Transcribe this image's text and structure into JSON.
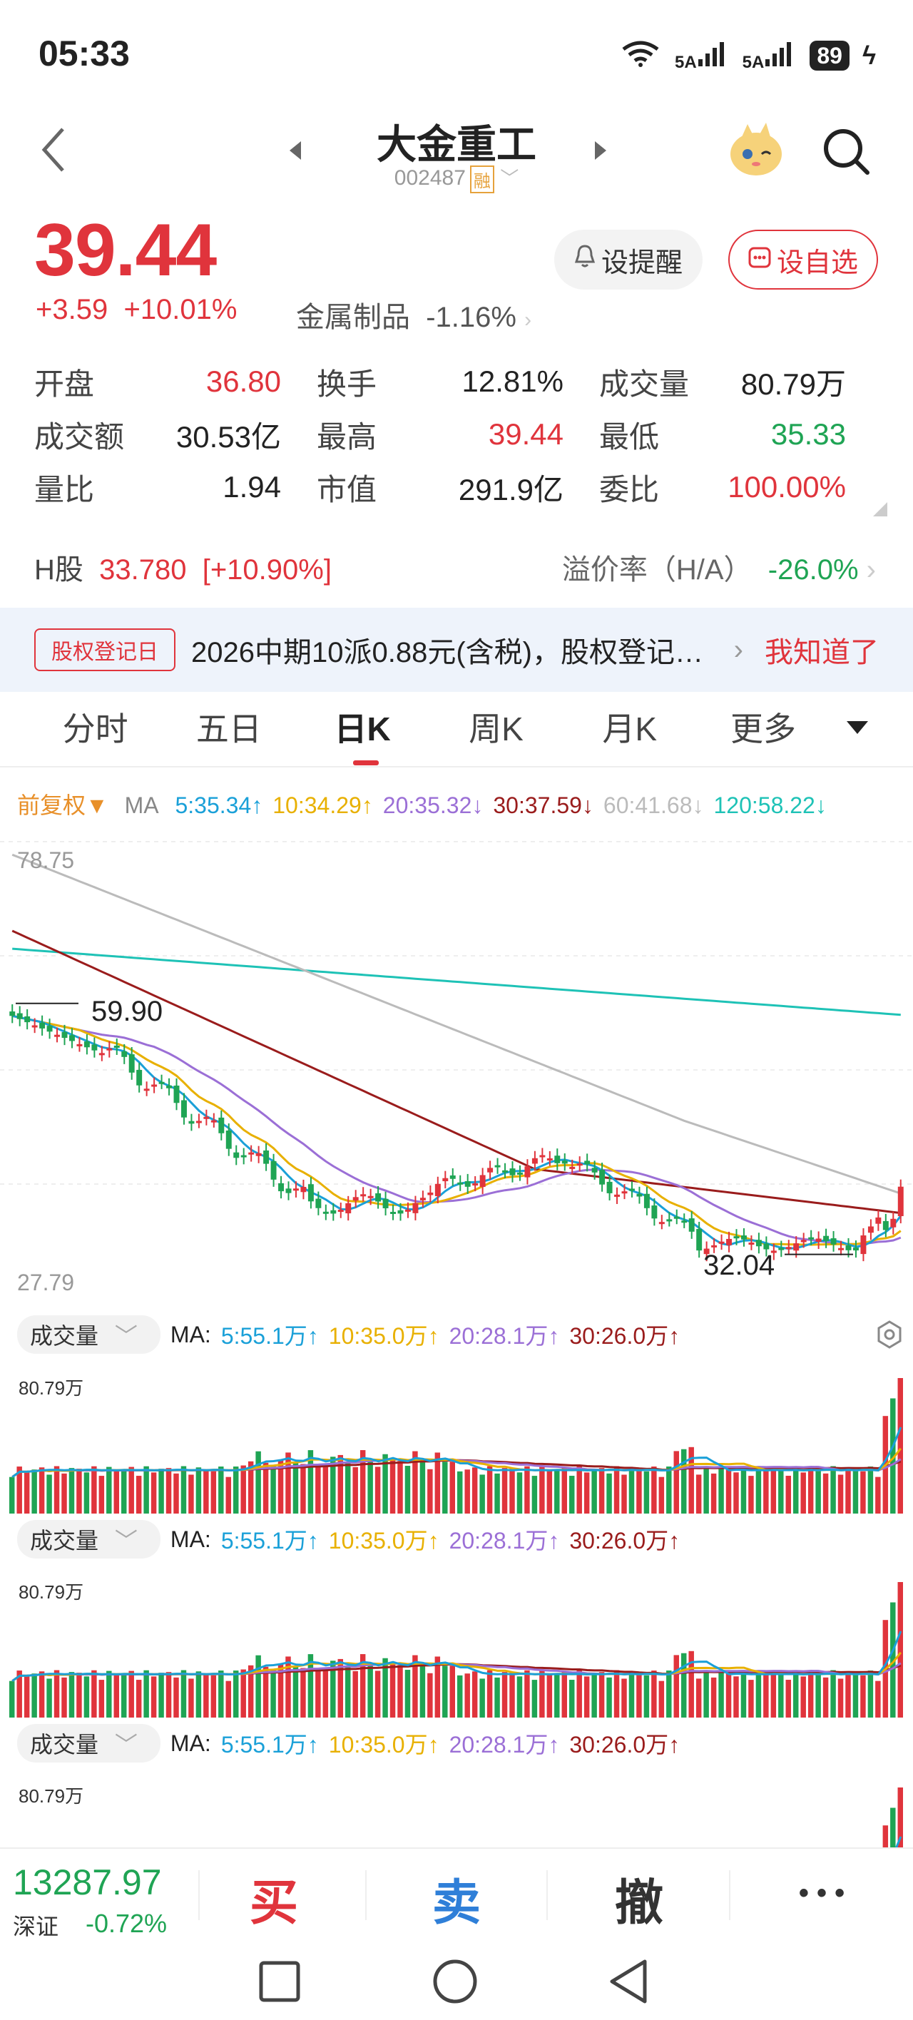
{
  "status": {
    "time": "05:33",
    "signal1": "5A",
    "signal2": "5A",
    "wifi": "6",
    "battery": "89"
  },
  "header": {
    "title": "大金重工",
    "code": "002487",
    "margin_badge": "融"
  },
  "quote": {
    "price": "39.44",
    "change": "+3.59",
    "change_pct": "+10.01%",
    "sector_name": "金属制品",
    "sector_pct": "-1.16%",
    "alert_btn": "设提醒",
    "watch_btn": "设自选"
  },
  "stats": [
    [
      {
        "k": "开盘",
        "v": "36.80",
        "c": "red"
      },
      {
        "k": "换手",
        "v": "12.81%",
        "c": "blk"
      },
      {
        "k": "成交量",
        "v": "80.79万",
        "c": "blk"
      }
    ],
    [
      {
        "k": "成交额",
        "v": "30.53亿",
        "c": "blk"
      },
      {
        "k": "最高",
        "v": "39.44",
        "c": "red"
      },
      {
        "k": "最低",
        "v": "35.33",
        "c": "green"
      }
    ],
    [
      {
        "k": "量比",
        "v": "1.94",
        "c": "blk"
      },
      {
        "k": "市值",
        "v": "291.9亿",
        "c": "blk"
      },
      {
        "k": "委比",
        "v": "100.00%",
        "c": "red"
      }
    ]
  ],
  "hshare": {
    "label": "H股",
    "price": "33.780",
    "pct": "[+10.90%]",
    "premium_label": "溢价率（H/A）",
    "premium": "-26.0%"
  },
  "notice": {
    "tag": "股权登记日",
    "text": "2026中期10派0.88元(含税)，股权登记日...",
    "action": "我知道了"
  },
  "tabs": [
    "分时",
    "五日",
    "日K",
    "周K",
    "月K",
    "更多"
  ],
  "active_tab": "日K",
  "ma": {
    "adj": "前复权▼",
    "label": "MA",
    "items": [
      {
        "t": "5:35.34↑",
        "color": "#1aa0d8"
      },
      {
        "t": "10:34.29↑",
        "color": "#e8b000"
      },
      {
        "t": "20:35.32↓",
        "color": "#9b6fd6"
      },
      {
        "t": "30:37.59↓",
        "color": "#9a1c1c"
      },
      {
        "t": "60:41.68↓",
        "color": "#bbbbbb"
      },
      {
        "t": "120:58.22↓",
        "color": "#1ec2b6"
      }
    ]
  },
  "kline": {
    "max": "78.75",
    "min": "27.79",
    "high_mark": "59.90",
    "low_mark": "32.04"
  },
  "volume": {
    "label": "成交量",
    "ma_label": "MA:",
    "items": [
      {
        "t": "5:55.1万↑",
        "color": "#1aa0d8"
      },
      {
        "t": "10:35.0万↑",
        "color": "#e8b000"
      },
      {
        "t": "20:28.1万↑",
        "color": "#9b6fd6"
      },
      {
        "t": "30:26.0万↑",
        "color": "#9a1c1c"
      }
    ],
    "max": "80.79万"
  },
  "index": {
    "value": "13287.97",
    "name": "深证",
    "pct": "-0.72%"
  },
  "trade": {
    "buy": "买",
    "sell": "卖",
    "cancel": "撤",
    "more": "• • •"
  },
  "colors": {
    "up": "#e0343c",
    "down": "#1fa454"
  }
}
